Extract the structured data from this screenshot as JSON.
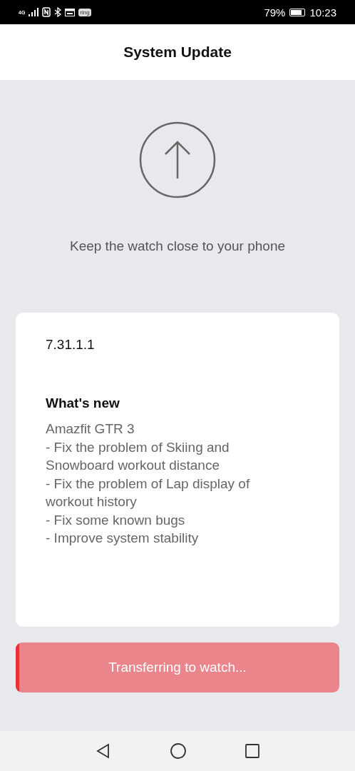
{
  "status_bar": {
    "network": "4G",
    "app_badge": "ring",
    "battery": "79%",
    "time": "10:23"
  },
  "header": {
    "title": "System Update"
  },
  "hint": "Keep the watch close to your phone",
  "card": {
    "version": "7.31.1.1",
    "heading": "What's new",
    "notes": [
      "Amazfit GTR 3",
      "- Fix the problem of Skiing and Snowboard workout distance",
      "- Fix the problem of Lap display of workout history",
      "- Fix some known bugs",
      "- Improve system stability"
    ]
  },
  "progress": {
    "label": "Transferring to watch...",
    "level": 0.01
  }
}
